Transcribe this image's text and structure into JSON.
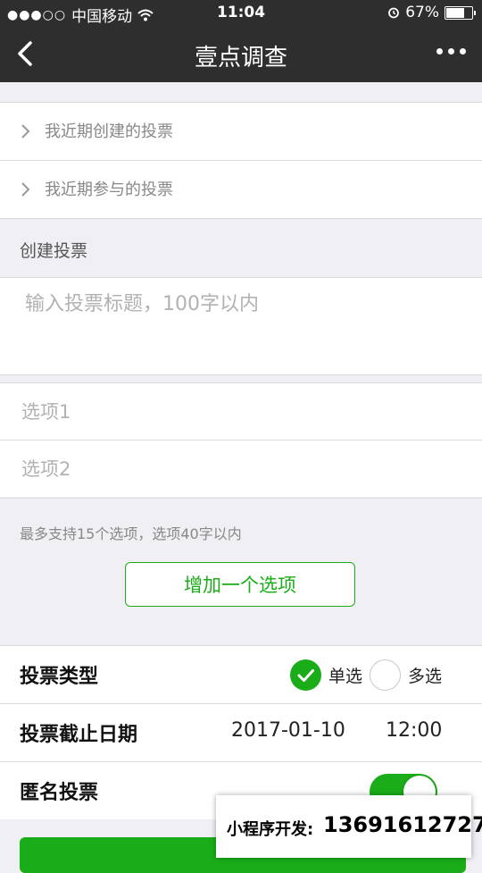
{
  "status_bar": {
    "signal": "●●●○○",
    "carrier": "中国移动",
    "time": "11:04",
    "battery": "67%"
  },
  "nav": {
    "title": "壹点调查"
  },
  "links": [
    {
      "label": "我近期创建的投票"
    },
    {
      "label": "我近期参与的投票"
    }
  ],
  "create_section": {
    "label": "创建投票",
    "title_placeholder": "输入投票标题，100字以内",
    "options": [
      {
        "placeholder": "选项1"
      },
      {
        "placeholder": "选项2"
      }
    ],
    "hint": "最多支持15个选项，选项40字以内",
    "add_option_label": "增加一个选项"
  },
  "settings": {
    "vote_type": {
      "label": "投票类型",
      "single_label": "单选",
      "multi_label": "多选",
      "selected": "单选"
    },
    "deadline": {
      "label": "投票截止日期",
      "date": "2017-01-10",
      "time": "12:00"
    },
    "anonymous": {
      "label": "匿名投票",
      "enabled": true
    }
  },
  "contact": {
    "label": "小程序开发:",
    "phone": "13691612727"
  },
  "colors": {
    "accent": "#1aad19",
    "nav_bg": "#2e2e2e",
    "page_bg": "#efeff4"
  }
}
